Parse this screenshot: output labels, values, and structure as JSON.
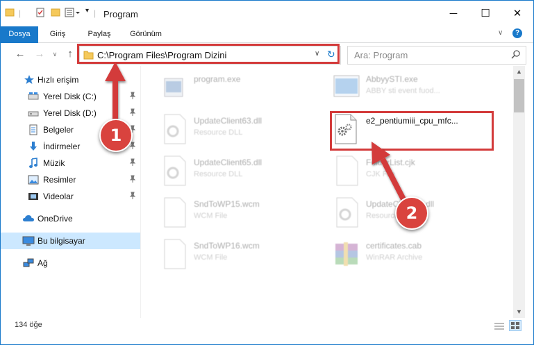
{
  "window": {
    "title": "Program"
  },
  "ribbon": {
    "tabs": [
      "Dosya",
      "Giriş",
      "Paylaş",
      "Görünüm"
    ]
  },
  "address": {
    "path": "C:\\Program Files\\Program Dizini"
  },
  "search": {
    "placeholder": "Ara: Program"
  },
  "sidebar": {
    "items": [
      {
        "label": "Hızlı erişim",
        "icon": "star-icon"
      },
      {
        "label": "Yerel Disk (C:)",
        "icon": "drive-icon",
        "pinned": true
      },
      {
        "label": "Yerel Disk (D:)",
        "icon": "drive-icon",
        "pinned": true
      },
      {
        "label": "Belgeler",
        "icon": "documents-icon",
        "pinned": true
      },
      {
        "label": "İndirmeler",
        "icon": "download-icon",
        "pinned": true
      },
      {
        "label": "Müzik",
        "icon": "music-icon",
        "pinned": true
      },
      {
        "label": "Resimler",
        "icon": "pictures-icon",
        "pinned": true
      },
      {
        "label": "Videolar",
        "icon": "videos-icon",
        "pinned": true
      },
      {
        "label": "OneDrive",
        "icon": "cloud-icon"
      },
      {
        "label": "Bu bilgisayar",
        "icon": "computer-icon",
        "selected": true
      },
      {
        "label": "Ağ",
        "icon": "network-icon"
      }
    ]
  },
  "files": [
    {
      "name": "program.exe",
      "type": "",
      "icon": "exe-icon"
    },
    {
      "name": "AbbyySTI.exe",
      "type": "ABBY sti event fuod...",
      "icon": "exe-icon"
    },
    {
      "name": "UpdateClient63.dll",
      "type": "Resource DLL",
      "icon": "dll-icon"
    },
    {
      "name": "e2_pentiumiii_cpu_mfc...",
      "type": "",
      "icon": "dll-icon"
    },
    {
      "name": "UpdateClient65.dll",
      "type": "Resource DLL",
      "icon": "dll-icon"
    },
    {
      "name": "FolderList.cjk",
      "type": "CJK File",
      "icon": "file-icon"
    },
    {
      "name": "SndToWP15.wcm",
      "type": "WCM File",
      "icon": "file-icon"
    },
    {
      "name": "UpdateClient66.dll",
      "type": "Resource DLL",
      "icon": "dll-icon"
    },
    {
      "name": "SndToWP16.wcm",
      "type": "WCM File",
      "icon": "file-icon"
    },
    {
      "name": "certificates.cab",
      "type": "WinRAR Archive",
      "icon": "archive-icon"
    }
  ],
  "status": {
    "count": "134 öğe"
  },
  "markers": [
    "1",
    "2"
  ],
  "colors": {
    "accent": "#1979ca",
    "highlight": "#d33a3a",
    "selection": "#cce8ff"
  }
}
